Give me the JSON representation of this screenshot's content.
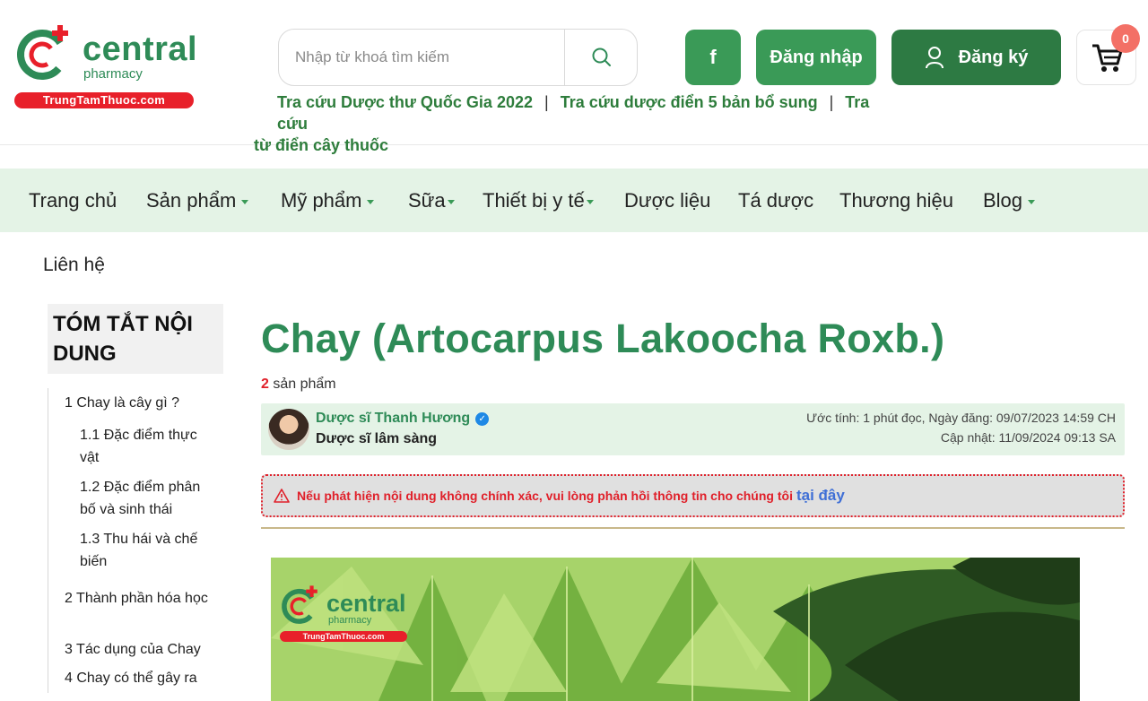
{
  "header": {
    "logo": {
      "brand": "central",
      "sub": "pharmacy",
      "tag": "TrungTamThuoc.com"
    },
    "search": {
      "placeholder": "Nhập từ khoá tìm kiếm"
    },
    "facebook_label": "f",
    "login_label": "Đăng nhập",
    "register_label": "Đăng ký",
    "cart_count": "0",
    "quick_links": [
      "Tra cứu Dược thư Quốc Gia 2022",
      "Tra cứu dược điển 5 bản bổ sung",
      "Tra cứu",
      "từ điển cây thuốc"
    ],
    "separator": "|"
  },
  "nav": {
    "items": [
      "Trang chủ",
      "Sản phẩm",
      "Mỹ phẩm",
      "Sữa",
      "Thiết bị y tế",
      "Dược liệu",
      "Tá dược",
      "Thương hiệu",
      "Blog"
    ],
    "contact": "Liên hệ"
  },
  "toc": {
    "title": "TÓM TẮT NỘI DUNG",
    "items": [
      "1   Chay là cây gì ?",
      "1.1   Đặc điểm thực vật",
      "1.2   Đặc điểm phân bố và sinh thái",
      "1.3   Thu hái và chế biến",
      "2   Thành phần hóa học",
      "3   Tác dụng của Chay",
      "4   Chay có thể gây ra"
    ]
  },
  "article": {
    "title": "Chay (Artocarpus Lakoocha Roxb.)",
    "count_number": "2",
    "count_label": "sản phẩm",
    "author_name": "Dược sĩ Thanh Hương",
    "author_role": "Dược sĩ lâm sàng",
    "meta_read": "Ước tính: 1 phút đọc, Ngày đăng: 09/07/2023 14:59 CH",
    "meta_updated": "Cập nhật: 11/09/2024 09:13 SA",
    "alert_text": "Nếu phát hiện nội dung không chính xác, vui lòng phản hồi thông tin cho chúng tôi",
    "alert_link": "tại đây"
  },
  "colors": {
    "brand_green": "#2e8b57",
    "button_green": "#3a9a57",
    "dark_green": "#2d7a43",
    "nav_bg": "#e4f3e6",
    "alert_red": "#e0202a"
  },
  "icons": [
    "search-icon",
    "facebook-icon",
    "user-icon",
    "cart-icon",
    "verified-icon",
    "warning-icon"
  ]
}
